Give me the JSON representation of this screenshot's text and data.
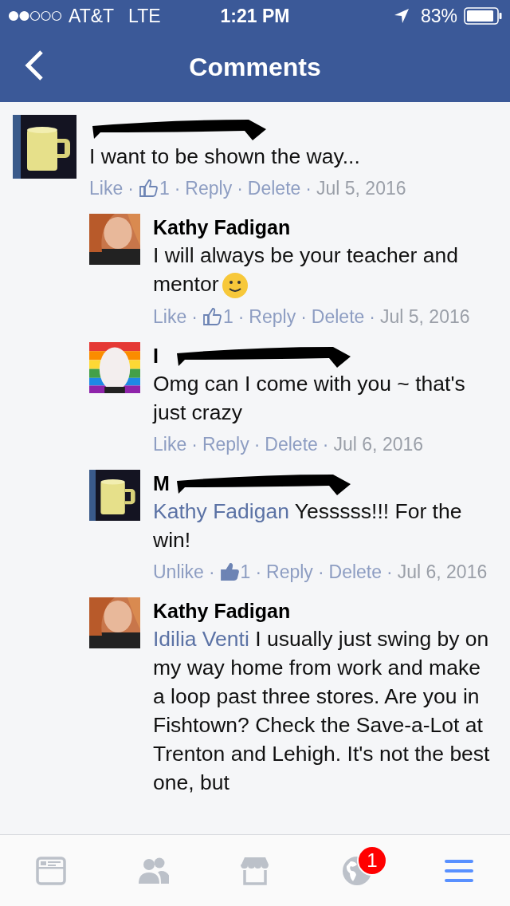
{
  "status_bar": {
    "carrier": "AT&T",
    "network": "LTE",
    "time": "1:21 PM",
    "battery": "83%"
  },
  "nav": {
    "title": "Comments"
  },
  "separator": "·",
  "comments": [
    {
      "reply": false,
      "avatar": {
        "kind": "picture"
      },
      "redacted": true,
      "text": "I want to be shown the way...",
      "emoji": false,
      "actions": [
        {
          "kind": "link",
          "label": "Like"
        },
        {
          "kind": "likes",
          "count": "1",
          "liked": false
        },
        {
          "kind": "link",
          "label": "Reply"
        },
        {
          "kind": "link",
          "label": "Delete"
        },
        {
          "kind": "date",
          "label": "Jul 5, 2016"
        }
      ]
    },
    {
      "reply": true,
      "avatar": {
        "kind": "picture"
      },
      "author": "Kathy Fadigan",
      "redacted": false,
      "text": "I will always be your teacher and mentor",
      "emoji": true,
      "actions": [
        {
          "kind": "link",
          "label": "Like"
        },
        {
          "kind": "likes",
          "count": "1",
          "liked": false
        },
        {
          "kind": "link",
          "label": "Reply"
        },
        {
          "kind": "link",
          "label": "Delete"
        },
        {
          "kind": "date",
          "label": "Jul 5, 2016"
        }
      ]
    },
    {
      "reply": true,
      "avatar": {
        "kind": "picture"
      },
      "author": "I",
      "redacted": true,
      "text": "Omg can I come with you ~ that's just crazy",
      "emoji": false,
      "actions": [
        {
          "kind": "link",
          "label": "Like"
        },
        {
          "kind": "link",
          "label": "Reply"
        },
        {
          "kind": "link",
          "label": "Delete"
        },
        {
          "kind": "date",
          "label": "Jul 6, 2016"
        }
      ]
    },
    {
      "reply": true,
      "avatar": {
        "kind": "picture"
      },
      "author": "M",
      "redacted": true,
      "mention": "Kathy Fadigan",
      "text": "Yesssss!!! For the win!",
      "emoji": false,
      "actions": [
        {
          "kind": "link",
          "label": "Unlike"
        },
        {
          "kind": "likes",
          "count": "1",
          "liked": true
        },
        {
          "kind": "link",
          "label": "Reply"
        },
        {
          "kind": "link",
          "label": "Delete"
        },
        {
          "kind": "date",
          "label": "Jul 6, 2016"
        }
      ]
    },
    {
      "reply": true,
      "avatar": {
        "kind": "picture"
      },
      "author": "Kathy Fadigan",
      "redacted": false,
      "mention": "Idilia Venti",
      "text": "I usually just swing by on my way home from work and make a loop past three stores. Are you in Fishtown? Check the Save-a-Lot at Trenton and Lehigh. It's not the best one, but",
      "emoji": false
    }
  ],
  "tabs": [
    {
      "kind": "feed",
      "selected": false
    },
    {
      "kind": "friends",
      "selected": false
    },
    {
      "kind": "market",
      "selected": false
    },
    {
      "kind": "globe",
      "selected": false,
      "badge": "1"
    },
    {
      "kind": "menu",
      "selected": true
    }
  ]
}
